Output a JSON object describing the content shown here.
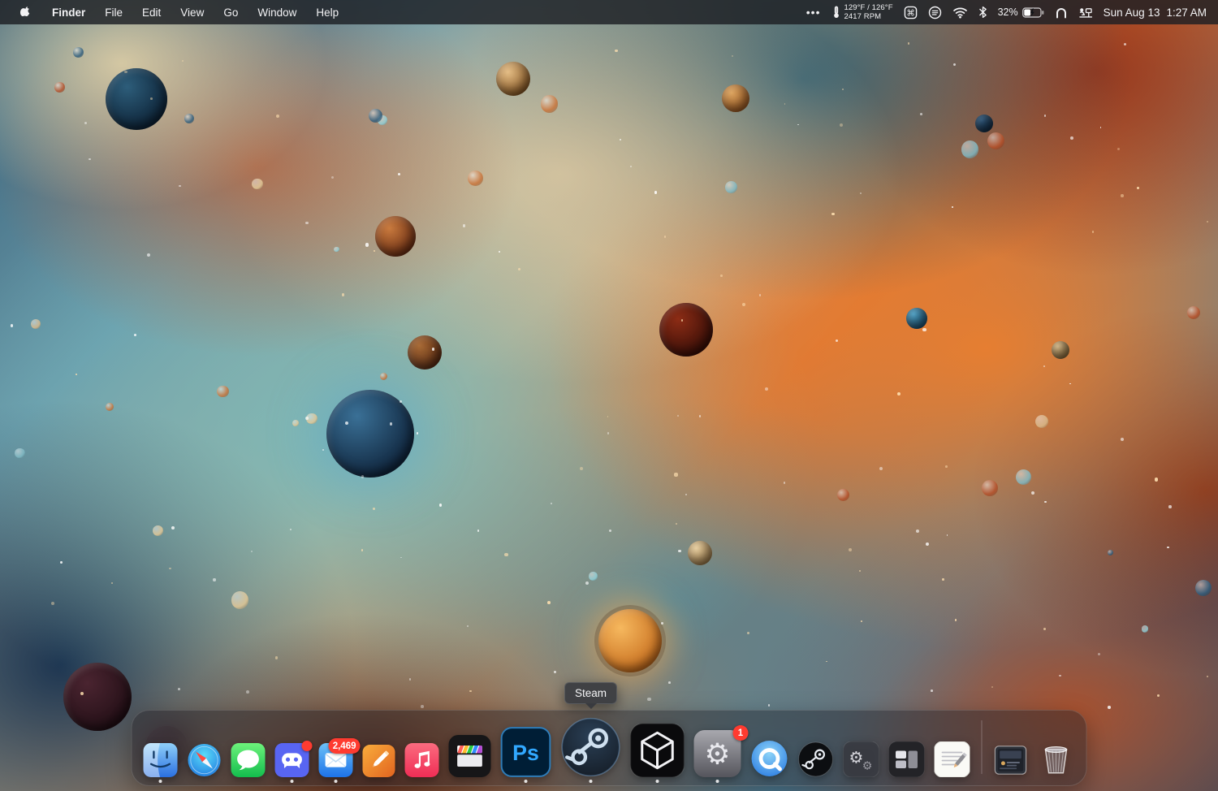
{
  "menu_bar": {
    "app_name": "Finder",
    "menus": [
      "File",
      "Edit",
      "View",
      "Go",
      "Window",
      "Help"
    ],
    "status": {
      "overflow": "•••",
      "temperature": "129°F / 126°F",
      "fan_rpm": "2417 RPM",
      "battery_percent": "32%",
      "date": "Sun Aug 13",
      "time": "1:27 AM"
    },
    "status_icon_names": [
      "thermometer-icon",
      "command-box-icon",
      "list-circle-icon",
      "wifi-icon",
      "bluetooth-icon",
      "battery-icon",
      "arch-icon",
      "workspace-icon"
    ]
  },
  "tooltip": {
    "label": "Steam"
  },
  "dock": {
    "items": [
      {
        "label": "Finder",
        "badge": null,
        "running": true
      },
      {
        "label": "Safari",
        "badge": null,
        "running": false
      },
      {
        "label": "Messages",
        "badge": null,
        "running": false
      },
      {
        "label": "Discord",
        "badge": "",
        "running": true
      },
      {
        "label": "Mail",
        "badge": "2,469",
        "running": true
      },
      {
        "label": "Pencil App",
        "badge": null,
        "running": false
      },
      {
        "label": "Music",
        "badge": null,
        "running": false
      },
      {
        "label": "Final Cut Pro",
        "badge": null,
        "running": false
      },
      {
        "label": "Photoshop",
        "badge": null,
        "running": true
      },
      {
        "label": "Steam",
        "badge": null,
        "running": true
      },
      {
        "label": "Cube App",
        "badge": null,
        "running": true
      },
      {
        "label": "System Settings",
        "badge": "1",
        "running": true
      },
      {
        "label": "QuickTime Player",
        "badge": null,
        "running": false
      },
      {
        "label": "Steam Helper",
        "badge": null,
        "running": false
      },
      {
        "label": "Utilities",
        "badge": null,
        "running": false
      },
      {
        "label": "Window Manager",
        "badge": null,
        "running": false
      },
      {
        "label": "TextEdit",
        "badge": null,
        "running": false
      },
      {
        "label": "Screenshot Preview",
        "badge": null,
        "running": false
      },
      {
        "label": "Trash",
        "badge": null,
        "running": false
      }
    ]
  },
  "colors": {
    "badge_red": "#ff3b30",
    "photoshop_blue": "#31a8ff",
    "accent_orange": "#ec7e2d",
    "accent_teal": "#70bec4"
  }
}
